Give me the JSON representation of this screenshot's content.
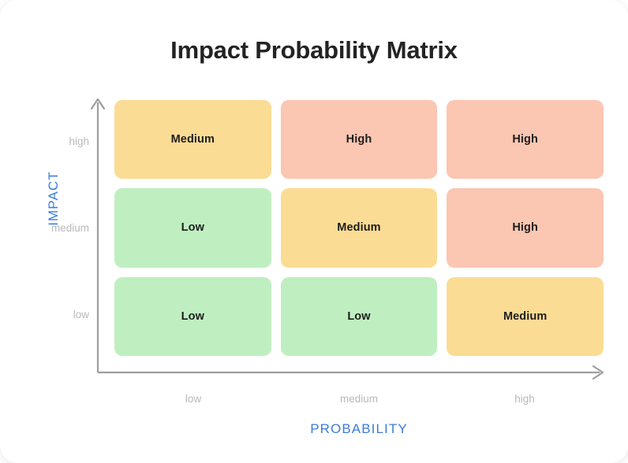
{
  "chart": {
    "title": "Impact Probability Matrix"
  },
  "axes": {
    "y": {
      "title": "IMPACT",
      "ticks": [
        "high",
        "medium",
        "low"
      ],
      "arrow": "up-arrow-icon"
    },
    "x": {
      "title": "PROBABILITY",
      "ticks": [
        "low",
        "medium",
        "high"
      ],
      "arrow": "right-arrow-icon"
    }
  },
  "colors": {
    "low": "#bfefc0",
    "medium": "#fbdc94",
    "high": "#fbc6b2",
    "axis_title": "#3b7dd8",
    "tick_label": "#b9b9b9",
    "axis_line": "#9e9e9e",
    "cell_text": "#1d1d1d",
    "title_text": "#232323",
    "card_bg": "#ffffff"
  },
  "chart_data": {
    "type": "heatmap",
    "title": "Impact Probability Matrix",
    "xlabel": "PROBABILITY",
    "ylabel": "IMPACT",
    "x_categories": [
      "low",
      "medium",
      "high"
    ],
    "y_categories": [
      "high",
      "medium",
      "low"
    ],
    "grid": false,
    "legend": "none",
    "cells": [
      {
        "row": "high",
        "col": "low",
        "label": "Medium",
        "level": "medium",
        "color": "#fbdc94"
      },
      {
        "row": "high",
        "col": "medium",
        "label": "High",
        "level": "high",
        "color": "#fbc6b2"
      },
      {
        "row": "high",
        "col": "high",
        "label": "High",
        "level": "high",
        "color": "#fbc6b2"
      },
      {
        "row": "medium",
        "col": "low",
        "label": "Low",
        "level": "low",
        "color": "#bfefc0"
      },
      {
        "row": "medium",
        "col": "medium",
        "label": "Medium",
        "level": "medium",
        "color": "#fbdc94"
      },
      {
        "row": "medium",
        "col": "high",
        "label": "High",
        "level": "high",
        "color": "#fbc6b2"
      },
      {
        "row": "low",
        "col": "low",
        "label": "Low",
        "level": "low",
        "color": "#bfefc0"
      },
      {
        "row": "low",
        "col": "medium",
        "label": "Low",
        "level": "low",
        "color": "#bfefc0"
      },
      {
        "row": "low",
        "col": "high",
        "label": "Medium",
        "level": "medium",
        "color": "#fbdc94"
      }
    ]
  }
}
